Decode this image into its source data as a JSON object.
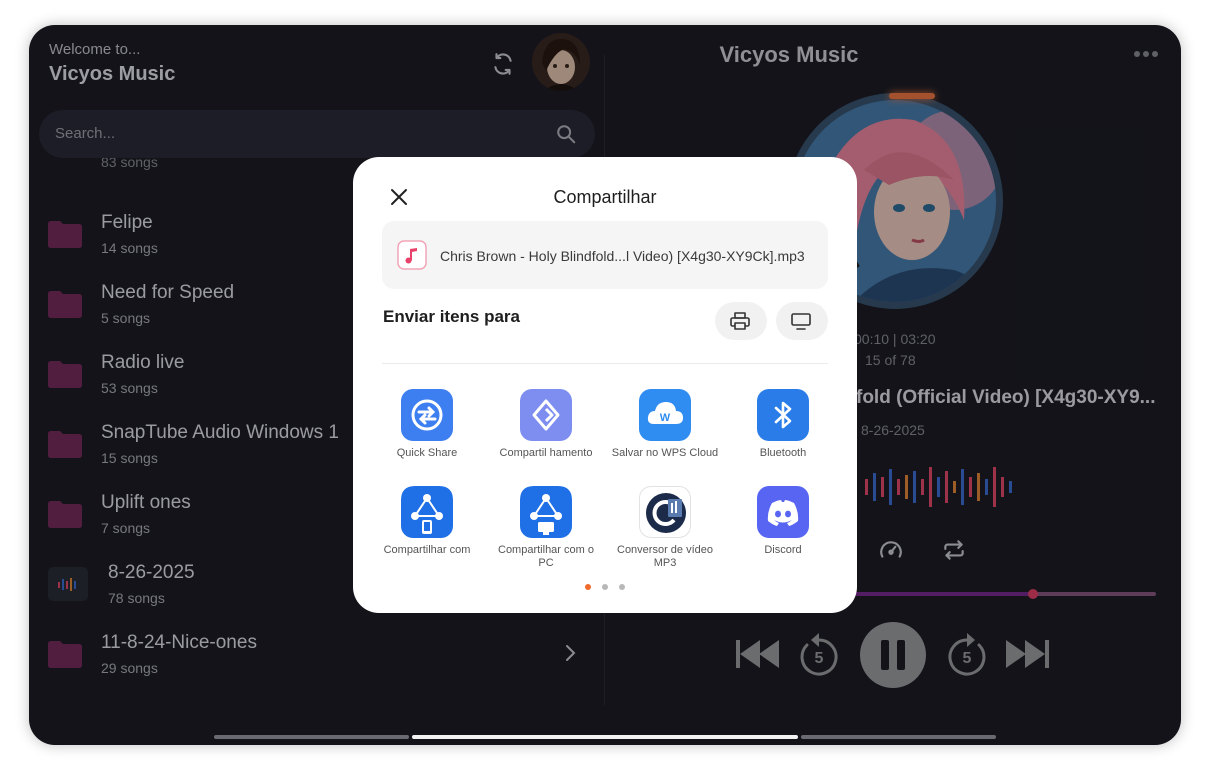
{
  "header": {
    "welcome": "Welcome to...",
    "app_title": "Vicyos Music"
  },
  "search": {
    "placeholder": "Search..."
  },
  "folders": {
    "partial_count": "83 songs",
    "items": [
      {
        "name": "Felipe",
        "count": "14 songs",
        "icon": "folder-icon"
      },
      {
        "name": "Need for Speed",
        "count": "5 songs",
        "icon": "folder-icon"
      },
      {
        "name": "Radio live",
        "count": "53 songs",
        "icon": "folder-icon"
      },
      {
        "name": "SnapTube Audio Windows 1",
        "count": "15 songs",
        "icon": "folder-icon"
      },
      {
        "name": "Uplift ones",
        "count": "7 songs",
        "icon": "folder-icon"
      },
      {
        "name": "8-26-2025",
        "count": "78 songs",
        "icon": "playlist-thumb-icon"
      },
      {
        "name": "11-8-24-Nice-ones",
        "count": "29 songs",
        "icon": "folder-icon"
      }
    ]
  },
  "player": {
    "title": "Vicyos Music",
    "time": "00:10 | 03:20",
    "track_position": "15 of 78",
    "track_title": "fold (Official Video) [X4g30-XY9...",
    "track_date": "8-26-2025",
    "progress": 0.59
  },
  "share_dialog": {
    "title": "Compartilhar",
    "file_name": "Chris Brown - Holy Blindfold...l Video) [X4g30-XY9Ck].mp3",
    "send_label": "Enviar itens para",
    "apps": [
      {
        "label": "Quick Share",
        "icon": "quick-share-icon"
      },
      {
        "label": "Compartil hamento",
        "icon": "nearby-share-icon"
      },
      {
        "label": "Salvar no WPS Cloud",
        "icon": "wps-cloud-icon"
      },
      {
        "label": "Bluetooth",
        "icon": "bluetooth-icon"
      },
      {
        "label": "Compartilhar com",
        "icon": "shareit-phone-icon"
      },
      {
        "label": "Compartilhar com o PC",
        "icon": "shareit-pc-icon"
      },
      {
        "label": "Conversor de vídeo MP3",
        "icon": "mp3-converter-icon"
      },
      {
        "label": "Discord",
        "icon": "discord-icon"
      }
    ],
    "page_count": 3,
    "active_page": 0
  },
  "colors": {
    "background": "#1c1d26",
    "folder": "#7a2d5e",
    "accent": "#e8426b",
    "dialog": "#ffffff"
  }
}
